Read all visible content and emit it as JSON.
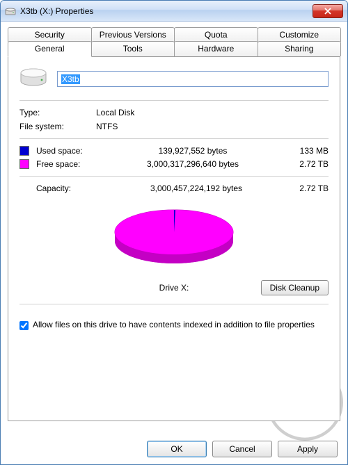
{
  "window": {
    "title": "X3tb (X:) Properties"
  },
  "tabs": {
    "row1": [
      "Security",
      "Previous Versions",
      "Quota",
      "Customize"
    ],
    "row2": [
      "General",
      "Tools",
      "Hardware",
      "Sharing"
    ],
    "active": "General"
  },
  "general": {
    "volume_name": "X3tb",
    "type_label": "Type:",
    "type_value": "Local Disk",
    "fs_label": "File system:",
    "fs_value": "NTFS",
    "used_label": "Used space:",
    "used_bytes": "139,927,552 bytes",
    "used_hr": "133 MB",
    "free_label": "Free space:",
    "free_bytes": "3,000,317,296,640 bytes",
    "free_hr": "2.72 TB",
    "capacity_label": "Capacity:",
    "capacity_bytes": "3,000,457,224,192 bytes",
    "capacity_hr": "2.72 TB",
    "drive_label": "Drive X:",
    "cleanup_label": "Disk Cleanup",
    "index_label": "Allow files on this drive to have contents indexed in addition to file properties",
    "index_checked": true,
    "colors": {
      "used": "#0000d0",
      "free": "#ff00ff"
    }
  },
  "buttons": {
    "ok": "OK",
    "cancel": "Cancel",
    "apply": "Apply"
  },
  "chart_data": {
    "type": "pie",
    "title": "Drive X:",
    "series": [
      {
        "name": "Used space",
        "value": 139927552,
        "label": "133 MB",
        "color": "#0000d0"
      },
      {
        "name": "Free space",
        "value": 3000317296640,
        "label": "2.72 TB",
        "color": "#ff00ff"
      }
    ],
    "total": {
      "name": "Capacity",
      "value": 3000457224192,
      "label": "2.72 TB"
    }
  }
}
